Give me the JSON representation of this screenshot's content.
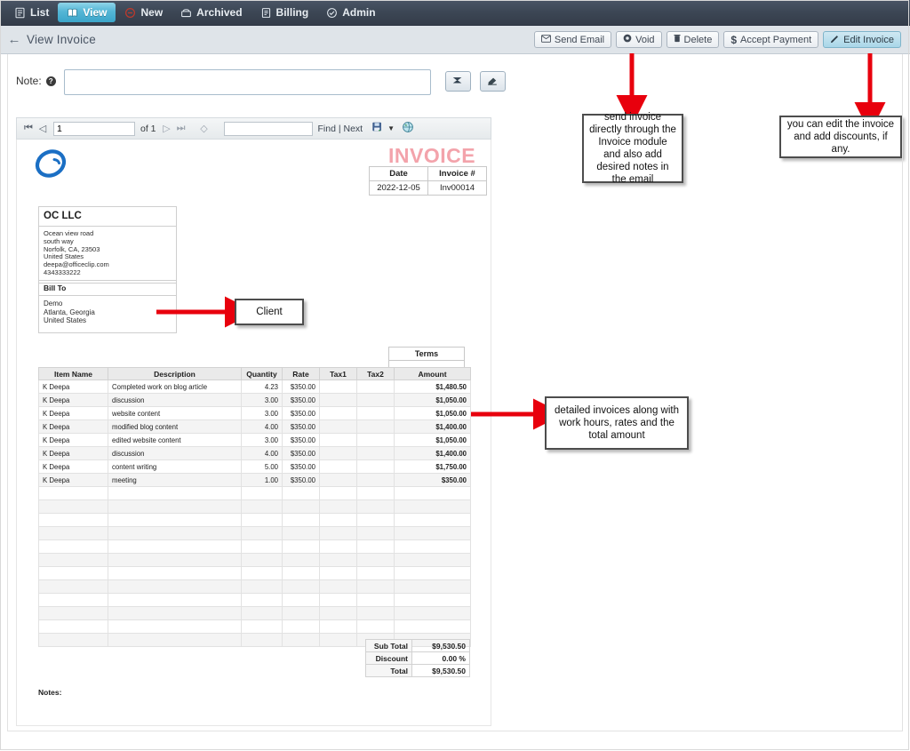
{
  "nav": {
    "items": [
      {
        "label": "List",
        "icon": "list-icon",
        "active": false
      },
      {
        "label": "View",
        "icon": "book-icon",
        "active": true
      },
      {
        "label": "New",
        "icon": "new-icon",
        "active": false
      },
      {
        "label": "Archived",
        "icon": "archive-icon",
        "active": false
      },
      {
        "label": "Billing",
        "icon": "billing-icon",
        "active": false
      },
      {
        "label": "Admin",
        "icon": "shield-icon",
        "active": false
      }
    ]
  },
  "header": {
    "back_glyph": "←",
    "title": "View Invoice",
    "buttons": [
      {
        "label": "Send Email",
        "icon": "envelope-icon",
        "primary": false
      },
      {
        "label": "Void",
        "icon": "void-icon",
        "primary": false
      },
      {
        "label": "Delete",
        "icon": "trash-icon",
        "primary": false
      },
      {
        "label": "Accept Payment",
        "icon": "dollar-icon",
        "primary": false
      },
      {
        "label": "Edit Invoice",
        "icon": "pencil-icon",
        "primary": true
      }
    ]
  },
  "note": {
    "label": "Note:",
    "help_glyph": "?",
    "value": "",
    "placeholder": "",
    "send_icon": "send-arrow-icon",
    "clear_icon": "eraser-icon"
  },
  "report_toolbar": {
    "first_glyph": "⏮",
    "prev_glyph": "◁",
    "page_value": "1",
    "of_label": "of 1",
    "next_glyph": "▷",
    "last_glyph": "⏭",
    "back_glyph": "◇",
    "find_value": "",
    "find_label": "Find | Next",
    "export_icon": "export-disk-icon",
    "refresh_icon": "refresh-globe-icon"
  },
  "invoice": {
    "title": "INVOICE",
    "title_color": "#f3a3ab",
    "logo_icon": "officeclip-logo-icon",
    "meta": {
      "headers": [
        "Date",
        "Invoice #"
      ],
      "values": [
        "2022-12-05",
        "Inv00014"
      ]
    },
    "company": {
      "name": "OC LLC",
      "lines": [
        "Ocean view road",
        "south way",
        "Norfolk, CA, 23503",
        "United States",
        "deepa@officeclip.com",
        "4343333222"
      ]
    },
    "bill_to": {
      "heading": "Bill To",
      "lines": [
        "Demo",
        "Atlanta, Georgia",
        "United States"
      ]
    },
    "terms": {
      "heading": "Terms",
      "value": ""
    },
    "items": {
      "columns": [
        "Item Name",
        "Description",
        "Quantity",
        "Rate",
        "Tax1",
        "Tax2",
        "Amount"
      ],
      "rows": [
        {
          "item": "K Deepa",
          "description": "Completed work on blog article",
          "quantity": "4.23",
          "rate": "$350.00",
          "tax1": "",
          "tax2": "",
          "amount": "$1,480.50"
        },
        {
          "item": "K Deepa",
          "description": "discussion",
          "quantity": "3.00",
          "rate": "$350.00",
          "tax1": "",
          "tax2": "",
          "amount": "$1,050.00"
        },
        {
          "item": "K Deepa",
          "description": "website content",
          "quantity": "3.00",
          "rate": "$350.00",
          "tax1": "",
          "tax2": "",
          "amount": "$1,050.00"
        },
        {
          "item": "K Deepa",
          "description": "modified blog content",
          "quantity": "4.00",
          "rate": "$350.00",
          "tax1": "",
          "tax2": "",
          "amount": "$1,400.00"
        },
        {
          "item": "K Deepa",
          "description": "edited website content",
          "quantity": "3.00",
          "rate": "$350.00",
          "tax1": "",
          "tax2": "",
          "amount": "$1,050.00"
        },
        {
          "item": "K Deepa",
          "description": "discussion",
          "quantity": "4.00",
          "rate": "$350.00",
          "tax1": "",
          "tax2": "",
          "amount": "$1,400.00"
        },
        {
          "item": "K Deepa",
          "description": "content writing",
          "quantity": "5.00",
          "rate": "$350.00",
          "tax1": "",
          "tax2": "",
          "amount": "$1,750.00"
        },
        {
          "item": "K Deepa",
          "description": "meeting",
          "quantity": "1.00",
          "rate": "$350.00",
          "tax1": "",
          "tax2": "",
          "amount": "$350.00"
        }
      ],
      "empty_row_count": 12
    },
    "totals": [
      {
        "label": "Sub Total",
        "value": "$9,530.50"
      },
      {
        "label": "Discount",
        "value": "0.00 %"
      },
      {
        "label": "Total",
        "value": "$9,530.50"
      }
    ],
    "notes_label": "Notes:"
  },
  "annotations": {
    "accent_color": "#e8000d",
    "callouts": [
      {
        "id": "send-email",
        "text": "send invoice directly through the Invoice module and also add desired notes in the email"
      },
      {
        "id": "edit-invoice",
        "text": "you can edit the invoice and add discounts, if any."
      },
      {
        "id": "client",
        "text": "Client"
      },
      {
        "id": "items",
        "text": "detailed invoices along with work hours, rates and the total amount"
      }
    ]
  }
}
